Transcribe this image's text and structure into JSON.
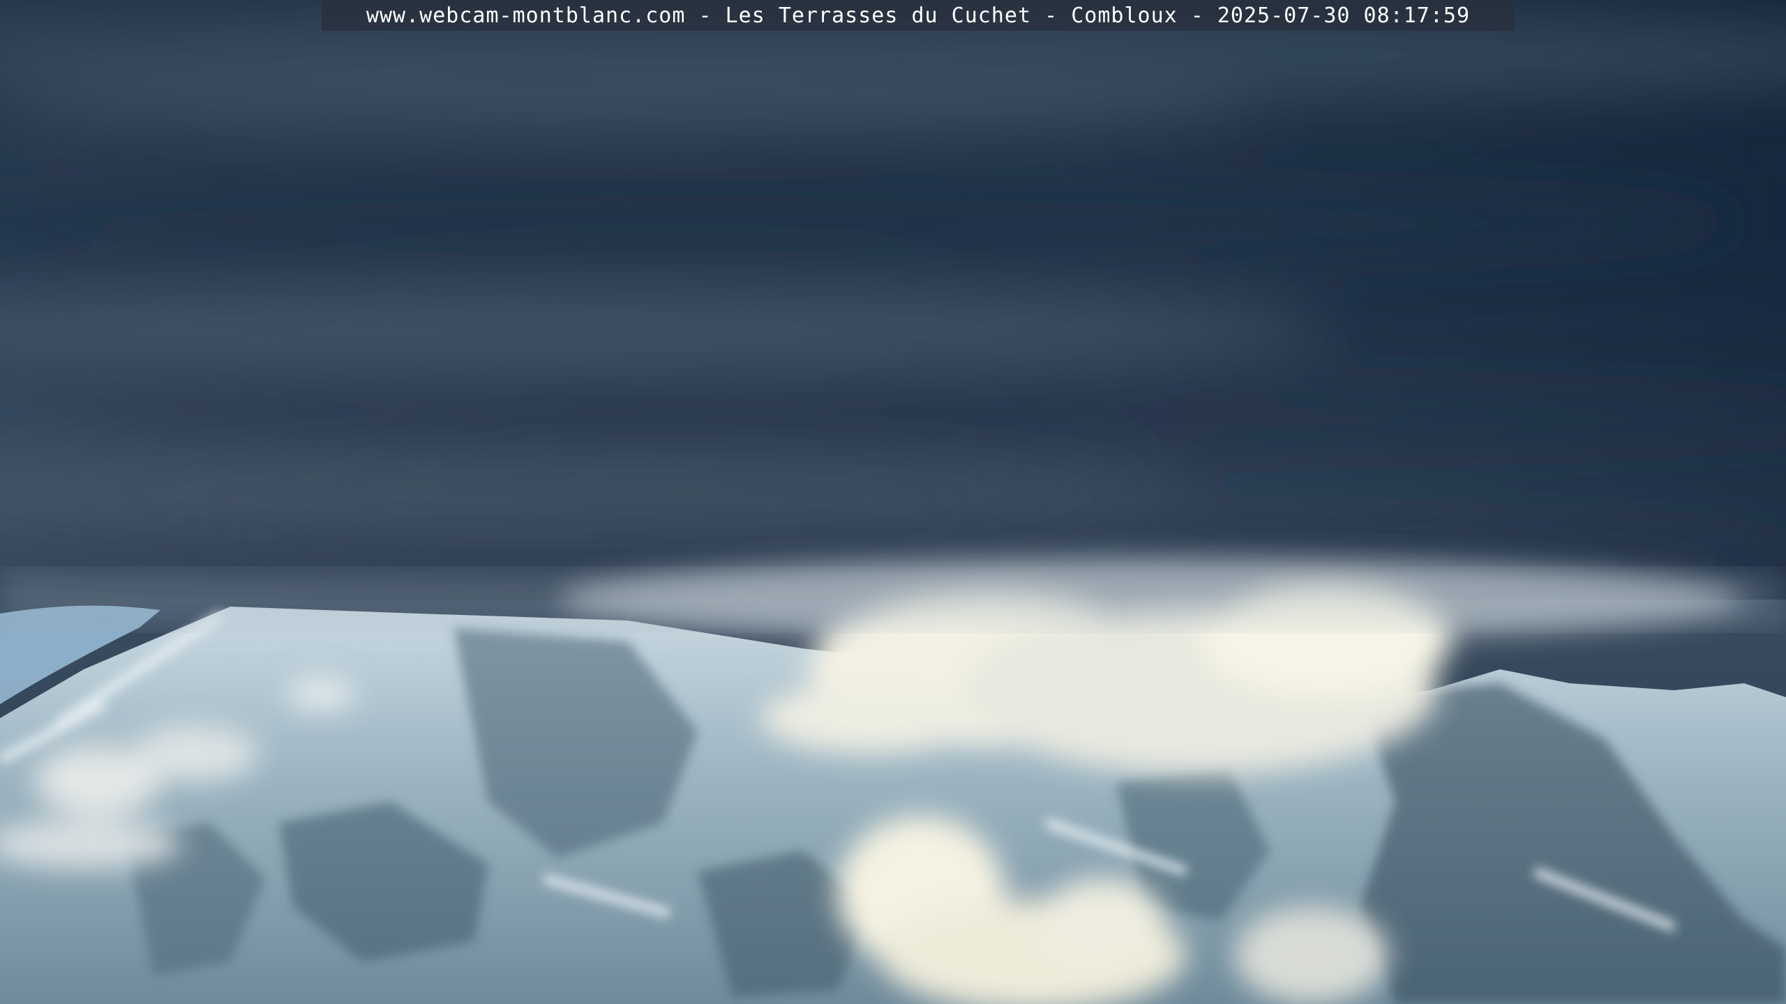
{
  "overlay": {
    "caption": "www.webcam-montblanc.com - Les Terrasses du Cuchet - Combloux - 2025-07-30 08:17:59"
  },
  "colors": {
    "sky_top": "#27384c",
    "sky_mid": "#3c4e62",
    "sky_right": "#1a2c44",
    "cloud_light": "#f3f1e4",
    "snow": "#dfe9ef",
    "rock": "#3f5666"
  }
}
